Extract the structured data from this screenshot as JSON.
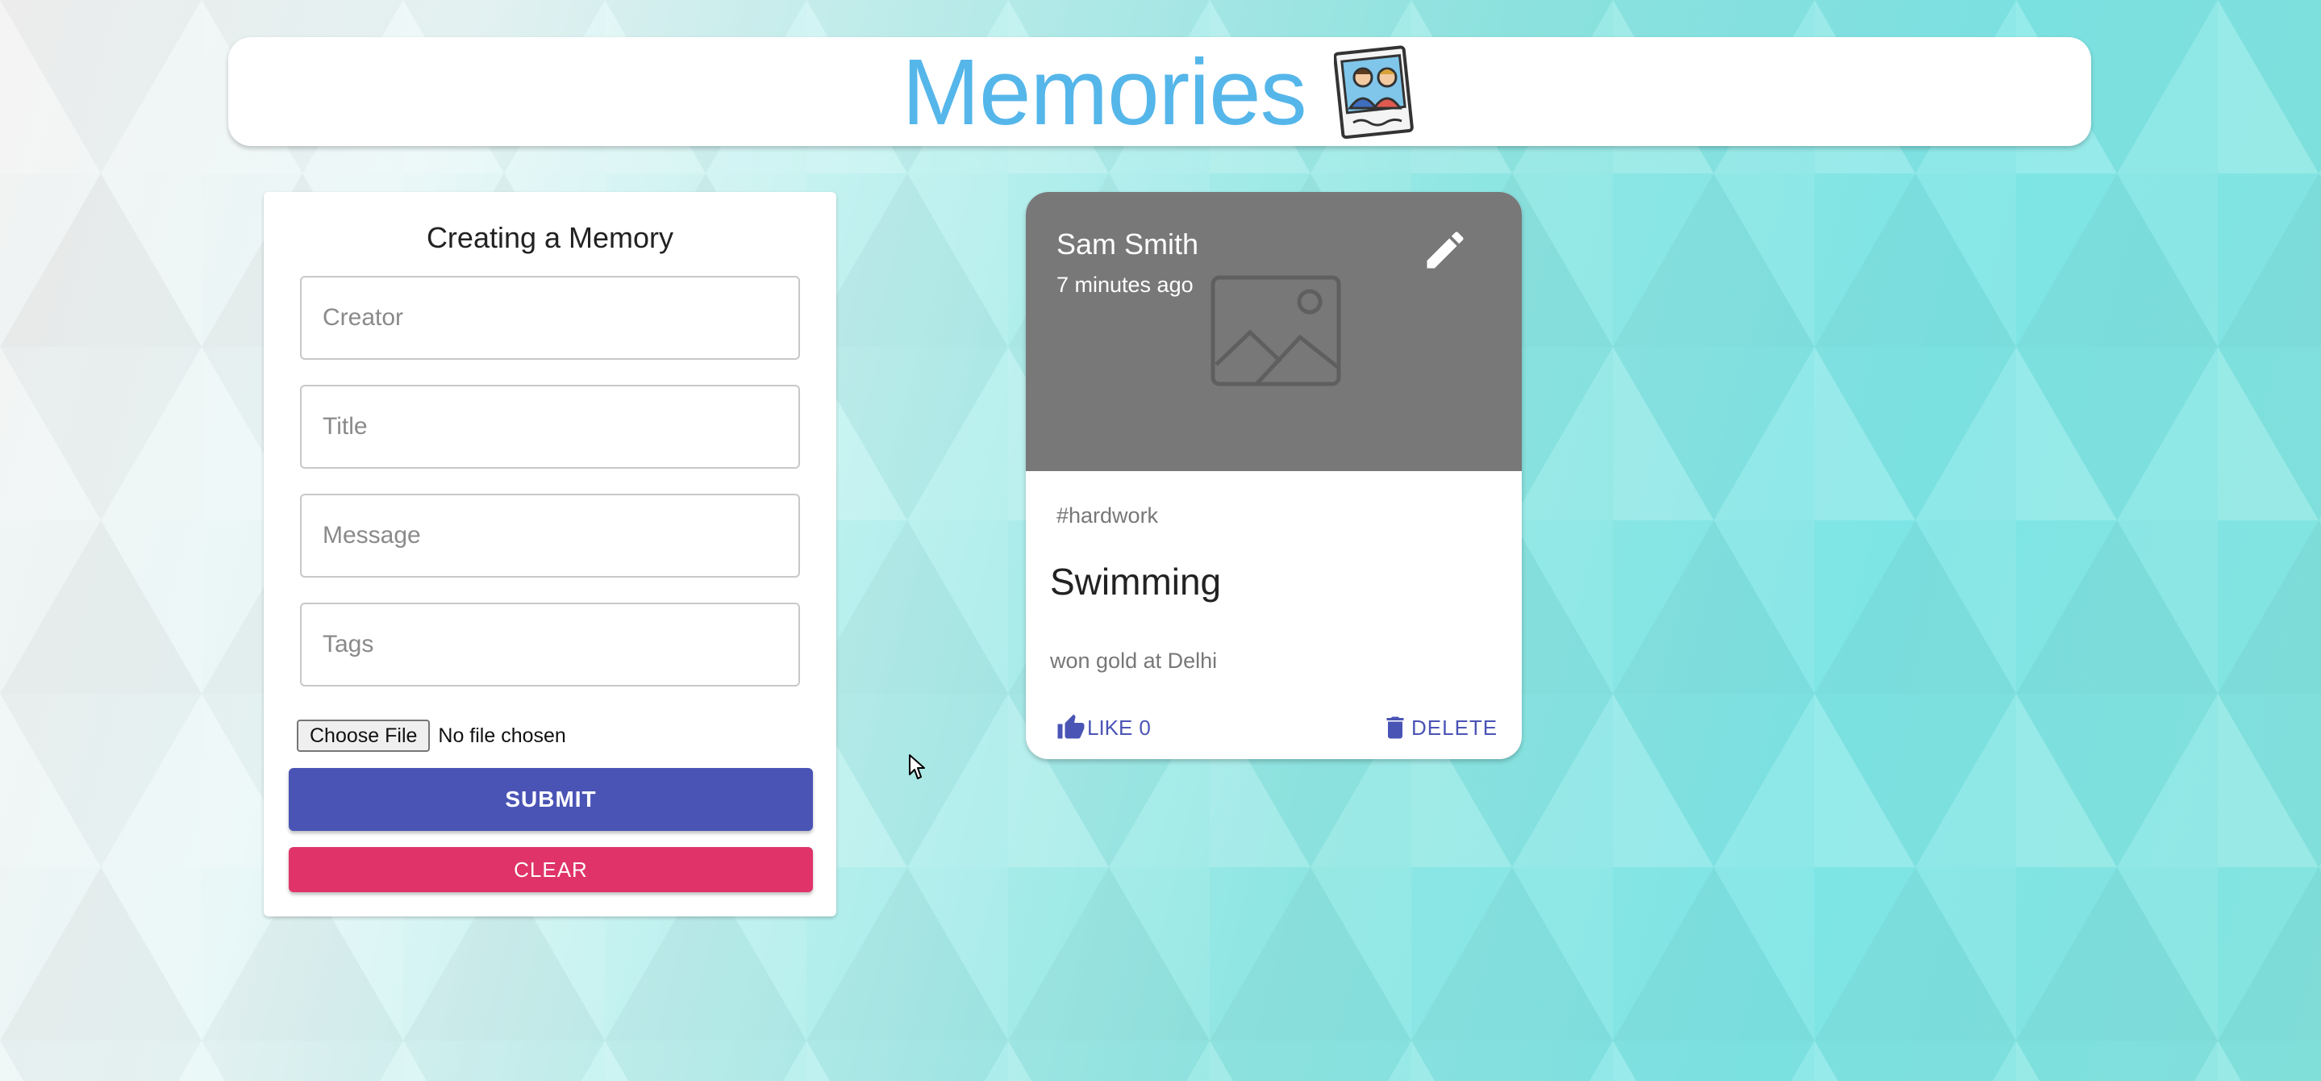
{
  "header": {
    "title": "Memories",
    "logo_icon": "memories-photo-icon",
    "title_color": "#55b6ea"
  },
  "form": {
    "heading": "Creating a Memory",
    "fields": {
      "creator": {
        "placeholder": "Creator",
        "value": ""
      },
      "title": {
        "placeholder": "Title",
        "value": ""
      },
      "message": {
        "placeholder": "Message",
        "value": ""
      },
      "tags": {
        "placeholder": "Tags",
        "value": ""
      }
    },
    "file_button": "Choose File",
    "file_status": "No file chosen",
    "submit_label": "SUBMIT",
    "clear_label": "CLEAR",
    "submit_color": "#4a54b5",
    "clear_color": "#e0336a"
  },
  "posts": [
    {
      "creator": "Sam Smith",
      "time": "7 minutes ago",
      "tags": "#hardwork",
      "title": "Swimming",
      "message": "won gold at Delhi",
      "like_label": "LIKE",
      "like_count": "0",
      "delete_label": "DELETE",
      "edit_icon": "pencil-icon",
      "media_icon": "image-placeholder-icon"
    }
  ]
}
